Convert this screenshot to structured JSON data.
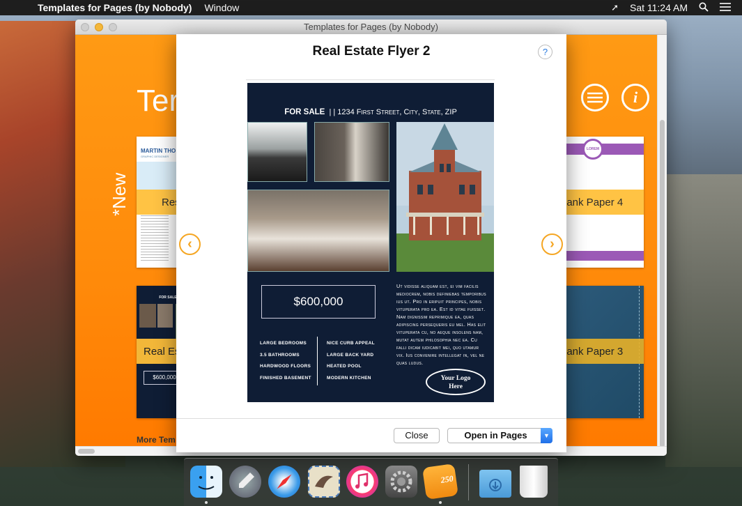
{
  "menubar": {
    "apple": "",
    "app_name": "Templates for Pages (by Nobody)",
    "window_menu": "Window",
    "clock": "Sat 11:24 AM"
  },
  "window": {
    "title": "Templates for Pages (by Nobody)",
    "big_title": "Ter",
    "new_label": "*New",
    "more_label": "More Tem",
    "cards": [
      {
        "band": "Res"
      },
      {
        "band": "lank Paper 4"
      },
      {
        "band": "Real Es"
      },
      {
        "band": "lank Paper 3"
      }
    ],
    "card_texts": {
      "resume_name": "MARTIN THO",
      "resume_sub": "GRAPHIC DESIGNER",
      "lorem_badge": "LOREM",
      "mini_forsale": "FOR SALE",
      "mini_price": "$600,000"
    }
  },
  "sheet": {
    "title": "Real Estate Flyer 2",
    "help": "?",
    "prev": "‹",
    "next": "›",
    "close_label": "Close",
    "open_label": "Open in Pages"
  },
  "flyer": {
    "for_sale": "FOR SALE",
    "address": "| | 1234 First Street, City, State, ZIP",
    "price": "$600,000",
    "features_left": [
      "LARGE BEDROOMS",
      "3.5 BATHROOMS",
      "HARDWOOD FLOORS",
      "FINISHED BASEMENT"
    ],
    "features_right": [
      "NICE CURB APPEAL",
      "LARGE BACK YARD",
      "HEATED POOL",
      "MODERN KITCHEN"
    ],
    "body": "Ut vidisse aliquam est, ei vim facilis mediocrem, nobis definiebas temporibus ius ut. Pro in eripuit principes, nobis vituperata pro ea. Est id vitae fuisset. Nam dignissim reprimique ea, quas adipiscing persequeris eu mel. Has elit vituperata cu, no aeque insolens nam, mutat autem philosophia nec ea. Cu falli dicam iudicabit mei, quo utamur vix. Ius convenire intellegat in, vel ne quas ludus.",
    "logo_line1": "Your Logo",
    "logo_line2": "Here"
  },
  "dock": [
    "finder-icon",
    "launchpad-icon",
    "safari-icon",
    "mail-icon",
    "itunes-icon",
    "system-preferences-icon",
    "templates-app-icon",
    "downloads-folder-icon",
    "trash-icon"
  ],
  "templates_badge": "250"
}
